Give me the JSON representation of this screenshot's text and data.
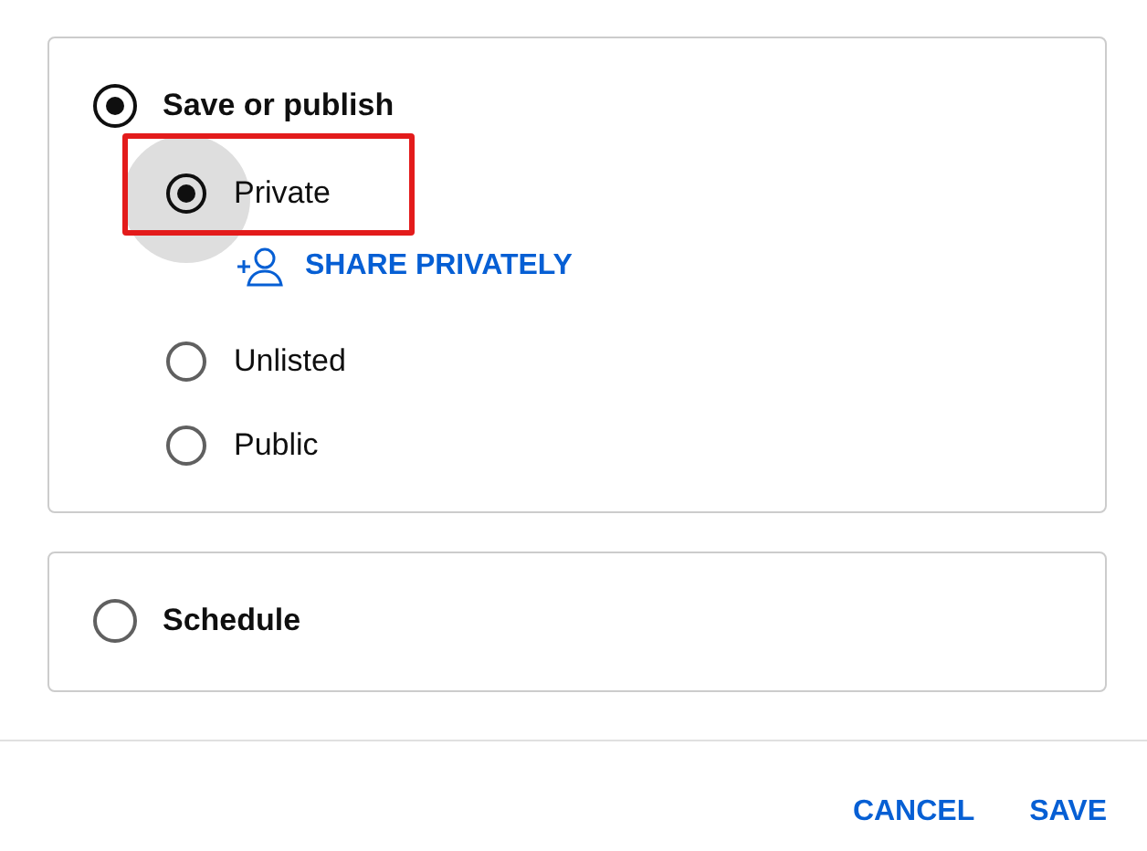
{
  "sections": [
    {
      "label": "Save or publish",
      "selected": true,
      "options": [
        {
          "label": "Private",
          "selected": true,
          "focused": true,
          "highlighted": true,
          "action": "SHARE PRIVATELY"
        },
        {
          "label": "Unlisted",
          "selected": false,
          "focused": false,
          "highlighted": false
        },
        {
          "label": "Public",
          "selected": false,
          "focused": false,
          "highlighted": false
        }
      ]
    },
    {
      "label": "Schedule",
      "selected": false
    }
  ],
  "buttons": [
    "CANCEL",
    "SAVE"
  ]
}
